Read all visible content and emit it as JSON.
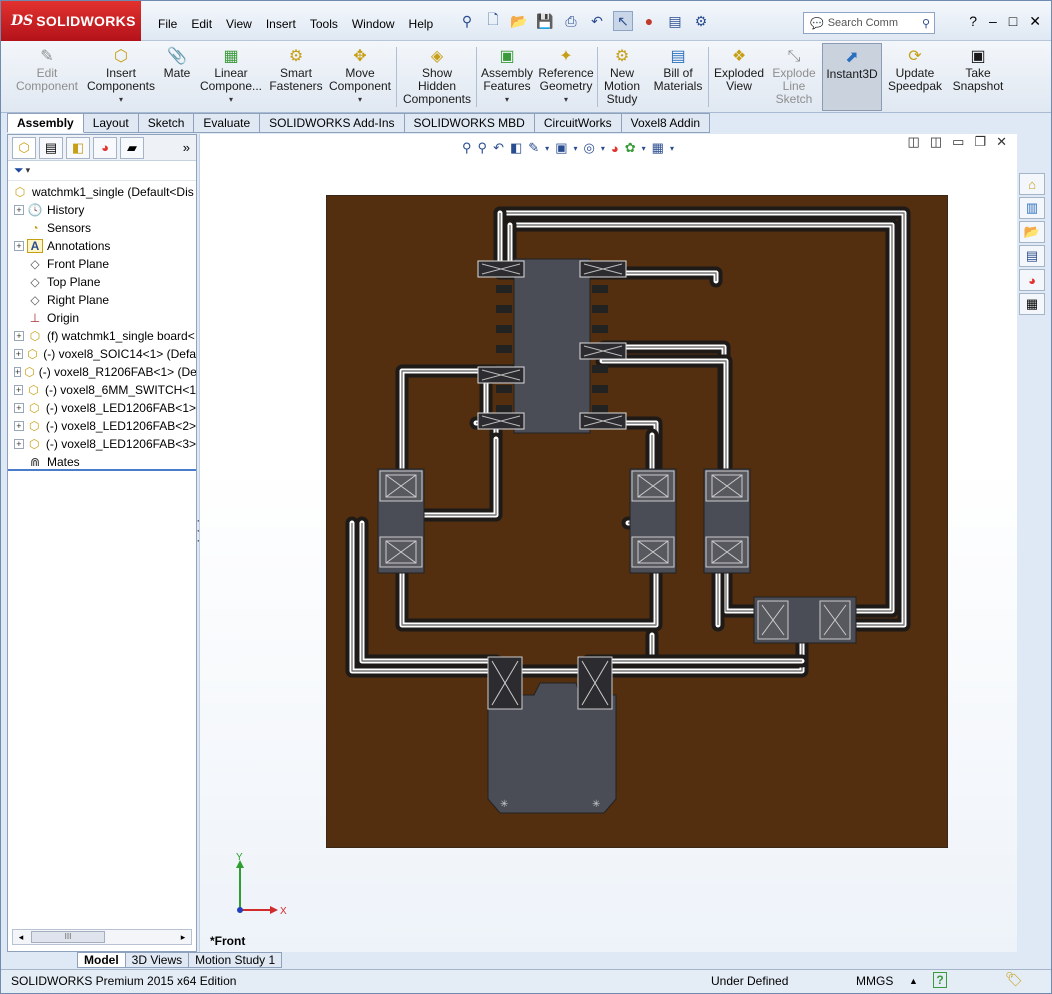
{
  "app": {
    "logo_mark": "DS",
    "logo_text": "SOLIDWORKS"
  },
  "menu": [
    "File",
    "Edit",
    "View",
    "Insert",
    "Tools",
    "Window",
    "Help"
  ],
  "search": {
    "placeholder": "Search Comm"
  },
  "commands": [
    {
      "label": "Edit\nComponent",
      "icon": "edit-component-icon",
      "disabled": true
    },
    {
      "label": "Insert\nComponents",
      "icon": "insert-components-icon"
    },
    {
      "label": "Mate",
      "icon": "mate-icon"
    },
    {
      "label": "Linear\nCompone...",
      "icon": "linear-pattern-icon"
    },
    {
      "label": "Smart\nFasteners",
      "icon": "smart-fasteners-icon"
    },
    {
      "label": "Move\nComponent",
      "icon": "move-component-icon"
    },
    {
      "label": "Show\nHidden\nComponents",
      "icon": "show-hidden-icon"
    },
    {
      "label": "Assembly\nFeatures",
      "icon": "assembly-features-icon"
    },
    {
      "label": "Reference\nGeometry",
      "icon": "reference-geometry-icon"
    },
    {
      "label": "New\nMotion\nStudy",
      "icon": "motion-study-icon"
    },
    {
      "label": "Bill of\nMaterials",
      "icon": "bill-of-materials-icon"
    },
    {
      "label": "Exploded\nView",
      "icon": "exploded-view-icon"
    },
    {
      "label": "Explode\nLine\nSketch",
      "icon": "explode-line-sketch-icon",
      "disabled": true
    },
    {
      "label": "Instant3D",
      "icon": "instant3d-icon",
      "active": true
    },
    {
      "label": "Update\nSpeedpak",
      "icon": "update-speedpak-icon"
    },
    {
      "label": "Take\nSnapshot",
      "icon": "take-snapshot-icon"
    }
  ],
  "cmd_tabs": [
    "Assembly",
    "Layout",
    "Sketch",
    "Evaluate",
    "SOLIDWORKS Add-Ins",
    "SOLIDWORKS MBD",
    "CircuitWorks",
    "Voxel8 Addin"
  ],
  "tree": {
    "root": "watchmk1_single  (Default<Dis",
    "items": [
      {
        "label": "History",
        "expand": true
      },
      {
        "label": "Sensors",
        "expand": false
      },
      {
        "label": "Annotations",
        "expand": true
      },
      {
        "label": "Front Plane",
        "expand": false
      },
      {
        "label": "Top Plane",
        "expand": false
      },
      {
        "label": "Right Plane",
        "expand": false
      },
      {
        "label": "Origin",
        "expand": false
      },
      {
        "label": "(f) watchmk1_single board<",
        "expand": true
      },
      {
        "label": "(-) voxel8_SOIC14<1> (Defa",
        "expand": true
      },
      {
        "label": "(-) voxel8_R1206FAB<1> (De",
        "expand": true
      },
      {
        "label": "(-) voxel8_6MM_SWITCH<1",
        "expand": true
      },
      {
        "label": "(-) voxel8_LED1206FAB<1>",
        "expand": true
      },
      {
        "label": "(-) voxel8_LED1206FAB<2>",
        "expand": true
      },
      {
        "label": "(-) voxel8_LED1206FAB<3>",
        "expand": true
      },
      {
        "label": "Mates",
        "expand": false
      }
    ]
  },
  "scroll_thumb": "III",
  "bottom_tabs": [
    "Model",
    "3D Views",
    "Motion Study 1"
  ],
  "view_name": "*Front",
  "triad": {
    "x": "X",
    "y": "Y"
  },
  "status": {
    "edition": "SOLIDWORKS Premium 2015 x64 Edition",
    "state": "Under Defined",
    "units": "MMGS",
    "arrow": "▲",
    "help": "?"
  },
  "colors": {
    "board": "#532f10",
    "trace": "#1e1a17",
    "pad": "#4a4c56",
    "accent": "#e2322f"
  }
}
